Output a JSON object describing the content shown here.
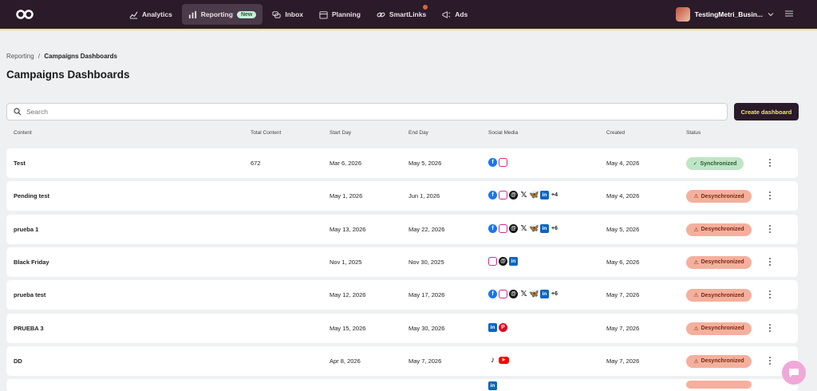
{
  "nav": {
    "items": [
      {
        "label": "Analytics",
        "icon": "chart-line-icon"
      },
      {
        "label": "Reporting",
        "icon": "bar-chart-icon",
        "badge": "New",
        "active": true
      },
      {
        "label": "Inbox",
        "icon": "chat-bubbles-icon"
      },
      {
        "label": "Planning",
        "icon": "calendar-icon"
      },
      {
        "label": "SmartLinks",
        "icon": "link-icon",
        "notification": true
      },
      {
        "label": "Ads",
        "icon": "megaphone-icon"
      }
    ],
    "user_name": "TestingMetri_Busin..."
  },
  "breadcrumb": {
    "parent": "Reporting",
    "separator": "/",
    "current": "Campaigns Dashboards"
  },
  "page_title": "Campaigns Dashboards",
  "search": {
    "placeholder": "Search",
    "value": ""
  },
  "create_button": "Create dashboard",
  "columns": [
    "Content",
    "Total Content",
    "Start Day",
    "End Day",
    "Social Media",
    "Created",
    "Status"
  ],
  "rows": [
    {
      "name": "Test",
      "total": "672",
      "start": "Mar 6, 2026",
      "end": "May 5, 2026",
      "socials": [
        "fb",
        "ig"
      ],
      "more": "",
      "created": "May 4, 2026",
      "status": "Synchronized",
      "status_type": "sync"
    },
    {
      "name": "Pending test",
      "total": "",
      "start": "May 1, 2026",
      "end": "Jun 1, 2026",
      "socials": [
        "fb",
        "ig",
        "th",
        "x",
        "bs",
        "li"
      ],
      "more": "+4",
      "created": "May 4, 2026",
      "status": "Desynchronized",
      "status_type": "desync"
    },
    {
      "name": "prueba 1",
      "total": "",
      "start": "May 13, 2026",
      "end": "May 22, 2026",
      "socials": [
        "fb",
        "ig",
        "th",
        "x",
        "bs",
        "li"
      ],
      "more": "+6",
      "created": "May 5, 2026",
      "status": "Desynchronized",
      "status_type": "desync"
    },
    {
      "name": "Black Friday",
      "total": "",
      "start": "Nov 1, 2025",
      "end": "Nov 30, 2025",
      "socials": [
        "ig",
        "th",
        "li"
      ],
      "more": "",
      "created": "May 6, 2026",
      "status": "Desynchronized",
      "status_type": "desync"
    },
    {
      "name": "prueba test",
      "total": "",
      "start": "May 12, 2026",
      "end": "May 17, 2026",
      "socials": [
        "fb",
        "ig",
        "th",
        "x",
        "bs",
        "li"
      ],
      "more": "+6",
      "created": "May 7, 2026",
      "status": "Desynchronized",
      "status_type": "desync"
    },
    {
      "name": "PRUEBA 3",
      "total": "",
      "start": "May 15, 2026",
      "end": "May 30, 2026",
      "socials": [
        "li",
        "pi"
      ],
      "more": "",
      "created": "May 7, 2026",
      "status": "Desynchronized",
      "status_type": "desync"
    },
    {
      "name": "DD",
      "total": "",
      "start": "Apr 8, 2026",
      "end": "May 7, 2026",
      "socials": [
        "tt",
        "yt"
      ],
      "more": "",
      "created": "May 7, 2026",
      "status": "Desynchronized",
      "status_type": "desync"
    },
    {
      "name": "",
      "total": "",
      "start": "",
      "end": "",
      "socials": [
        "li"
      ],
      "more": "",
      "created": "",
      "status": "",
      "status_type": "desync"
    }
  ],
  "colors": {
    "topbar": "#2a1a2a",
    "accent": "#f0e870",
    "sync": "#bfe5c6",
    "desync": "#f4b09c"
  }
}
